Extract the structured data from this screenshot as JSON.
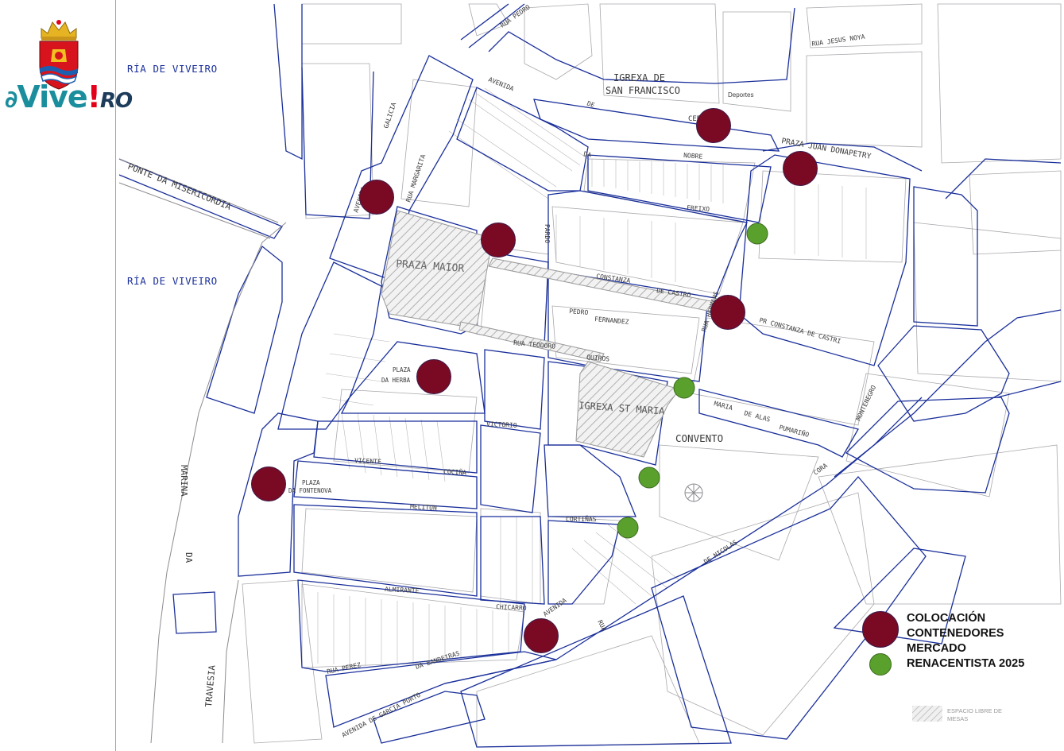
{
  "logo": {
    "brand_main": "Vive",
    "brand_mark": "!",
    "brand_suffix": "RO",
    "crest_icon": "coat-of-arms-icon"
  },
  "map_labels": {
    "ria_top": "RÍA DE VIVEIRO",
    "ria_mid": "RÍA DE VIVEIRO",
    "ponte": "PONTE DA MISERICORDIA",
    "igrexa_sf_1": "IGREXA DE",
    "igrexa_sf_2": "SAN FRANCISCO",
    "deportes": "Deportes",
    "praza_juan": "PRAZA JUAN DONAPETRY",
    "praza_maior": "PRAZA MAIOR",
    "igrexa_sm": "IGREXA ST MARIA",
    "convento": "CONVENTO",
    "plaza_herba_1": "PLAZA",
    "plaza_herba_2": "DA HERBA",
    "plaza_font_1": "PLAZA",
    "plaza_font_2": "DA FONTENOVA",
    "marina_1": "MARINA",
    "marina_2": "DA",
    "travesia": "TRAVESIA",
    "rua_pedro": "RUA PEDRO",
    "rua_jesus": "RUA  JESUS  NOYA",
    "avenida": "AVENIDA",
    "de": "DE",
    "cervantes": "CERVANTES",
    "nobre": "NOBRE",
    "freixo": "FREIXO",
    "da": "DA",
    "avenida_galicia_1": "AVENIDA",
    "avenida_galicia_2": "GALICIA",
    "rua_margarita": "RUA MARGARITA",
    "pardo": "PARDO",
    "rua_hermanos": "RUA HERMANS",
    "constanza": "CONSTANZA",
    "de_castro": "DE  CASTRO",
    "pedro": "PEDRO",
    "fernandez": "FERNANDEZ",
    "pr_constanza": "PR CONSTANZA DE CASTRI",
    "rua_teodoro": "RUA  TEODORO",
    "quiros": "QUIROS",
    "maria": "MARIA",
    "de_alas": "DE  ALAS",
    "pumarino": "PUMARIÑO",
    "montenegro": "MONTENEGRO",
    "cora": "CORA",
    "victorio": "VICTORIO",
    "vicente": "VICENTE",
    "cocina": "COCIÑA",
    "melitun": "MELITUN",
    "cortinas": "CORTIÑAS",
    "almirante": "ALMIRANTE",
    "chicarro": "CHICARRO",
    "rua_perez": "RUA  PEREZ",
    "da_bandeiras": "DA  BANDEIRAS",
    "avenida_garcia": "AVENIDA  DE  GARCIA  PORTO",
    "de_nicolas": "DE   NICOLAS",
    "avenida_s": "AVENIDA",
    "rua_s": "RUA"
  },
  "legend": {
    "line1": "COLOCACIÓN",
    "line2": "CONTENEDORES",
    "line3": "MERCADO",
    "line4": "RENACENTISTA 2025",
    "hatch_line1": "ESPACIO LIBRE DE",
    "hatch_line2": "MESAS"
  },
  "markers": {
    "container_count": 9,
    "green_count": 5
  },
  "colors": {
    "container_marker": "#7a0a24",
    "green_marker": "#5aa02c",
    "street_outline": "#1a2f9a",
    "building_outline": "#9a9aa0",
    "brand_teal": "#1b8e9e",
    "brand_red": "#e2001a"
  }
}
